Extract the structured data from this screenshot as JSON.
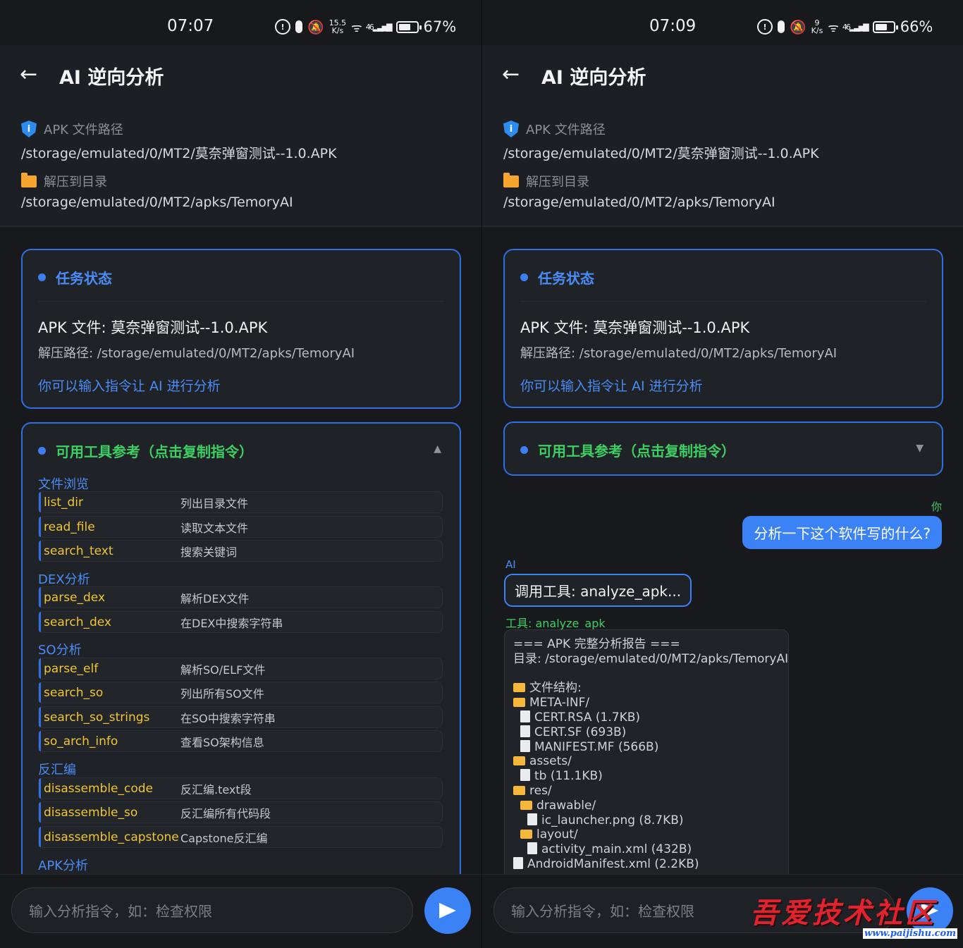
{
  "left": {
    "status": {
      "time": "07:07",
      "net_speed_value": "15.5",
      "net_speed_unit": "K/s",
      "battery": "67%",
      "battery_level": 0.67,
      "sig": "46"
    },
    "header": {
      "title": "AI 逆向分析",
      "apk_label": "APK 文件路径",
      "apk_path": "/storage/emulated/0/MT2/莫奈弹窗测试--1.0.APK",
      "extract_label": "解压到目录",
      "extract_path": "/storage/emulated/0/MT2/apks/TemoryAI"
    },
    "task": {
      "heading": "任务状态",
      "apk_line": "APK 文件: 莫奈弹窗测试--1.0.APK",
      "path_line": "解压路径: /storage/emulated/0/MT2/apks/TemoryAI",
      "hint": "你可以输入指令让 AI 进行分析"
    },
    "tools": {
      "heading": "可用工具参考（点击复制指令）",
      "arrow": "▲",
      "categories": [
        {
          "name": "文件浏览",
          "items": [
            {
              "name": "list_dir",
              "desc": "列出目录文件"
            },
            {
              "name": "read_file",
              "desc": "读取文本文件"
            },
            {
              "name": "search_text",
              "desc": "搜索关键词"
            }
          ]
        },
        {
          "name": "DEX分析",
          "items": [
            {
              "name": "parse_dex",
              "desc": "解析DEX文件"
            },
            {
              "name": "search_dex",
              "desc": "在DEX中搜索字符串"
            }
          ]
        },
        {
          "name": "SO分析",
          "items": [
            {
              "name": "parse_elf",
              "desc": "解析SO/ELF文件"
            },
            {
              "name": "search_so",
              "desc": "列出所有SO文件"
            },
            {
              "name": "search_so_strings",
              "desc": "在SO中搜索字符串"
            },
            {
              "name": "so_arch_info",
              "desc": "查看SO架构信息"
            }
          ]
        },
        {
          "name": "反汇编",
          "items": [
            {
              "name": "disassemble_code",
              "desc": "反汇编.text段"
            },
            {
              "name": "disassemble_so",
              "desc": "反汇编所有代码段"
            },
            {
              "name": "disassemble_capstone",
              "desc": "Capstone反汇编"
            }
          ]
        },
        {
          "name": "APK分析",
          "items": []
        }
      ]
    },
    "input": {
      "placeholder": "输入分析指令，如：检查权限"
    }
  },
  "right": {
    "status": {
      "time": "07:09",
      "net_speed_value": "9",
      "net_speed_unit": "K/s",
      "battery": "66%",
      "battery_level": 0.66,
      "sig": "46"
    },
    "header": {
      "title": "AI 逆向分析",
      "apk_label": "APK 文件路径",
      "apk_path": "/storage/emulated/0/MT2/莫奈弹窗测试--1.0.APK",
      "extract_label": "解压到目录",
      "extract_path": "/storage/emulated/0/MT2/apks/TemoryAI"
    },
    "task": {
      "heading": "任务状态",
      "apk_line": "APK 文件: 莫奈弹窗测试--1.0.APK",
      "path_line": "解压路径: /storage/emulated/0/MT2/apks/TemoryAI",
      "hint": "你可以输入指令让 AI 进行分析"
    },
    "tools": {
      "heading": "可用工具参考（点击复制指令）",
      "arrow": "▼"
    },
    "chat": {
      "user_label": "你",
      "user_message": "分析一下这个软件写的什么?",
      "ai_label": "AI",
      "ai_message": "调用工具: analyze_apk...",
      "tool_label": "工具: analyze_apk",
      "result_lines": [
        {
          "icon": "none",
          "text": "=== APK 完整分析报告 ==="
        },
        {
          "icon": "none",
          "text": "目录: /storage/emulated/0/MT2/apks/TemoryAI"
        },
        {
          "icon": "blank",
          "text": ""
        },
        {
          "icon": "folder",
          "indent": 0,
          "text": "文件结构:"
        },
        {
          "icon": "folder",
          "indent": 0,
          "text": "META-INF/"
        },
        {
          "icon": "file",
          "indent": 1,
          "text": "CERT.RSA (1.7KB)"
        },
        {
          "icon": "file",
          "indent": 1,
          "text": "CERT.SF (693B)"
        },
        {
          "icon": "file",
          "indent": 1,
          "text": "MANIFEST.MF (566B)"
        },
        {
          "icon": "folder",
          "indent": 0,
          "text": "assets/"
        },
        {
          "icon": "file",
          "indent": 1,
          "text": "tb (11.1KB)"
        },
        {
          "icon": "folder",
          "indent": 0,
          "text": "res/"
        },
        {
          "icon": "folder",
          "indent": 1,
          "text": "drawable/"
        },
        {
          "icon": "file",
          "indent": 2,
          "text": "ic_launcher.png (8.7KB)"
        },
        {
          "icon": "folder",
          "indent": 1,
          "text": "layout/"
        },
        {
          "icon": "file",
          "indent": 2,
          "text": "activity_main.xml (432B)"
        },
        {
          "icon": "file",
          "indent": 0,
          "text": "AndroidManifest.xml (2.2KB)"
        }
      ]
    },
    "input": {
      "placeholder": "输入分析指令，如：检查权限"
    },
    "watermark": {
      "main": "吾爱技术社区",
      "url": "www.paijishu.com"
    }
  }
}
